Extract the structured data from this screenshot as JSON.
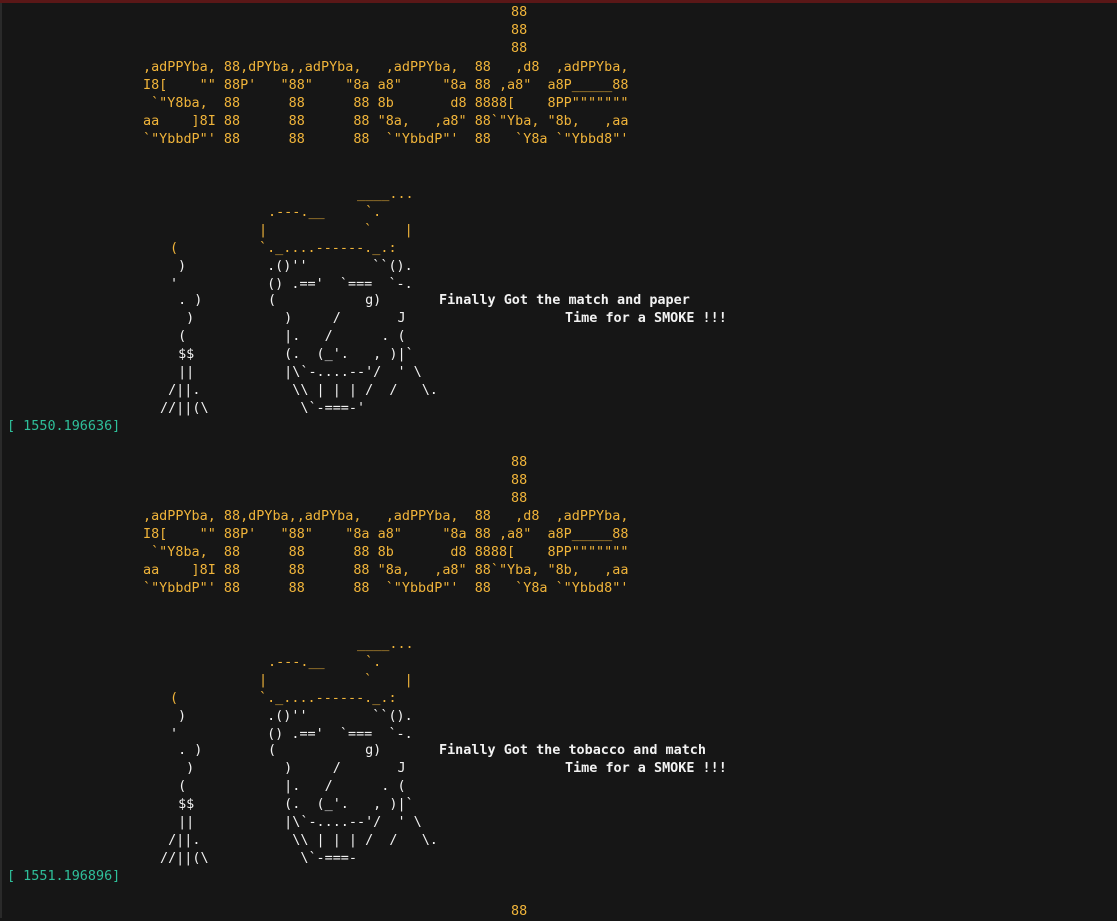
{
  "terminal": {
    "blocks": [
      {
        "logo": [
          "88",
          "88",
          "88",
          ",adPPYba, 88,dPYba,,adPYba,   ,adPPYba,  88   ,d8  ,adPPYba,",
          "I8[    \"\" 88P'   \"88\"    \"8a a8\"     \"8a 88 ,a8\"  a8P_____88",
          " `\"Y8ba,  88      88      88 8b       d8 8888[    8PP\"\"\"\"\"\"\"",
          "aa    ]8I 88      88      88 \"8a,   ,a8\" 88`\"Yba, \"8b,   ,aa",
          "`\"YbbdP\"' 88      88      88  `\"YbbdP\"'  88   `Y8a `\"Ybbd8\"'"
        ],
        "art_hat": [
          "____...",
          ".---.__     `.",
          "|            `    |",
          "`._....------._.:"
        ],
        "art_smoke": [
          "(",
          ")",
          "'"
        ],
        "art_body": [
          " .()''        ``().",
          " () .=='  `===  `-.",
          "(           g)",
          "  )     /       J",
          "  |.   /      . (",
          "  (.  (_'.   , )|`",
          "  |\\`-....--'/  ' \\",
          "   \\\\ | | | /  /   \\.",
          "    \\`-===-'"
        ],
        "art_pipe": [
          " . )",
          "  )",
          " (",
          " $$",
          " ||",
          " /||.",
          "//||(\\"
        ],
        "message_1": "Finally Got the match and paper",
        "message_2": "Time for a SMOKE !!!",
        "timestamp": "[ 1550.196636]"
      },
      {
        "logo": [
          "88",
          "88",
          "88",
          ",adPPYba, 88,dPYba,,adPYba,   ,adPPYba,  88   ,d8  ,adPPYba,",
          "I8[    \"\" 88P'   \"88\"    \"8a a8\"     \"8a 88 ,a8\"  a8P_____88",
          " `\"Y8ba,  88      88      88 8b       d8 8888[    8PP\"\"\"\"\"\"\"",
          "aa    ]8I 88      88      88 \"8a,   ,a8\" 88`\"Yba, \"8b,   ,aa",
          "`\"YbbdP\"' 88      88      88  `\"YbbdP\"'  88   `Y8a `\"Ybbd8\"'"
        ],
        "art_hat": [
          "____...",
          ".---.__     `.",
          "|            `    |",
          "`._....------._.:"
        ],
        "art_smoke": [
          "(",
          ")",
          "'"
        ],
        "art_body": [
          " .()''        ``().",
          " () .=='  `===  `-.",
          "(           g)",
          "  )     /       J",
          "  |.   /      . (",
          "  (.  (_'.   , )|`",
          "  |\\`-....--'/  ' \\",
          "   \\\\ | | | /  /   \\.",
          "    \\`-===-"
        ],
        "art_pipe": [
          " . )",
          "  )",
          " (",
          " $$",
          " ||",
          " /||.",
          "//||(\\"
        ],
        "message_1": "Finally Got the tobacco and match",
        "message_2": "Time for a SMOKE !!!",
        "timestamp": "[ 1551.196896]"
      }
    ],
    "trailing_logo_line": "88",
    "colors": {
      "background": "#161616",
      "art": "#f0b43a",
      "text": "#f2f2f2",
      "timestamp": "#2fbf9a"
    }
  }
}
